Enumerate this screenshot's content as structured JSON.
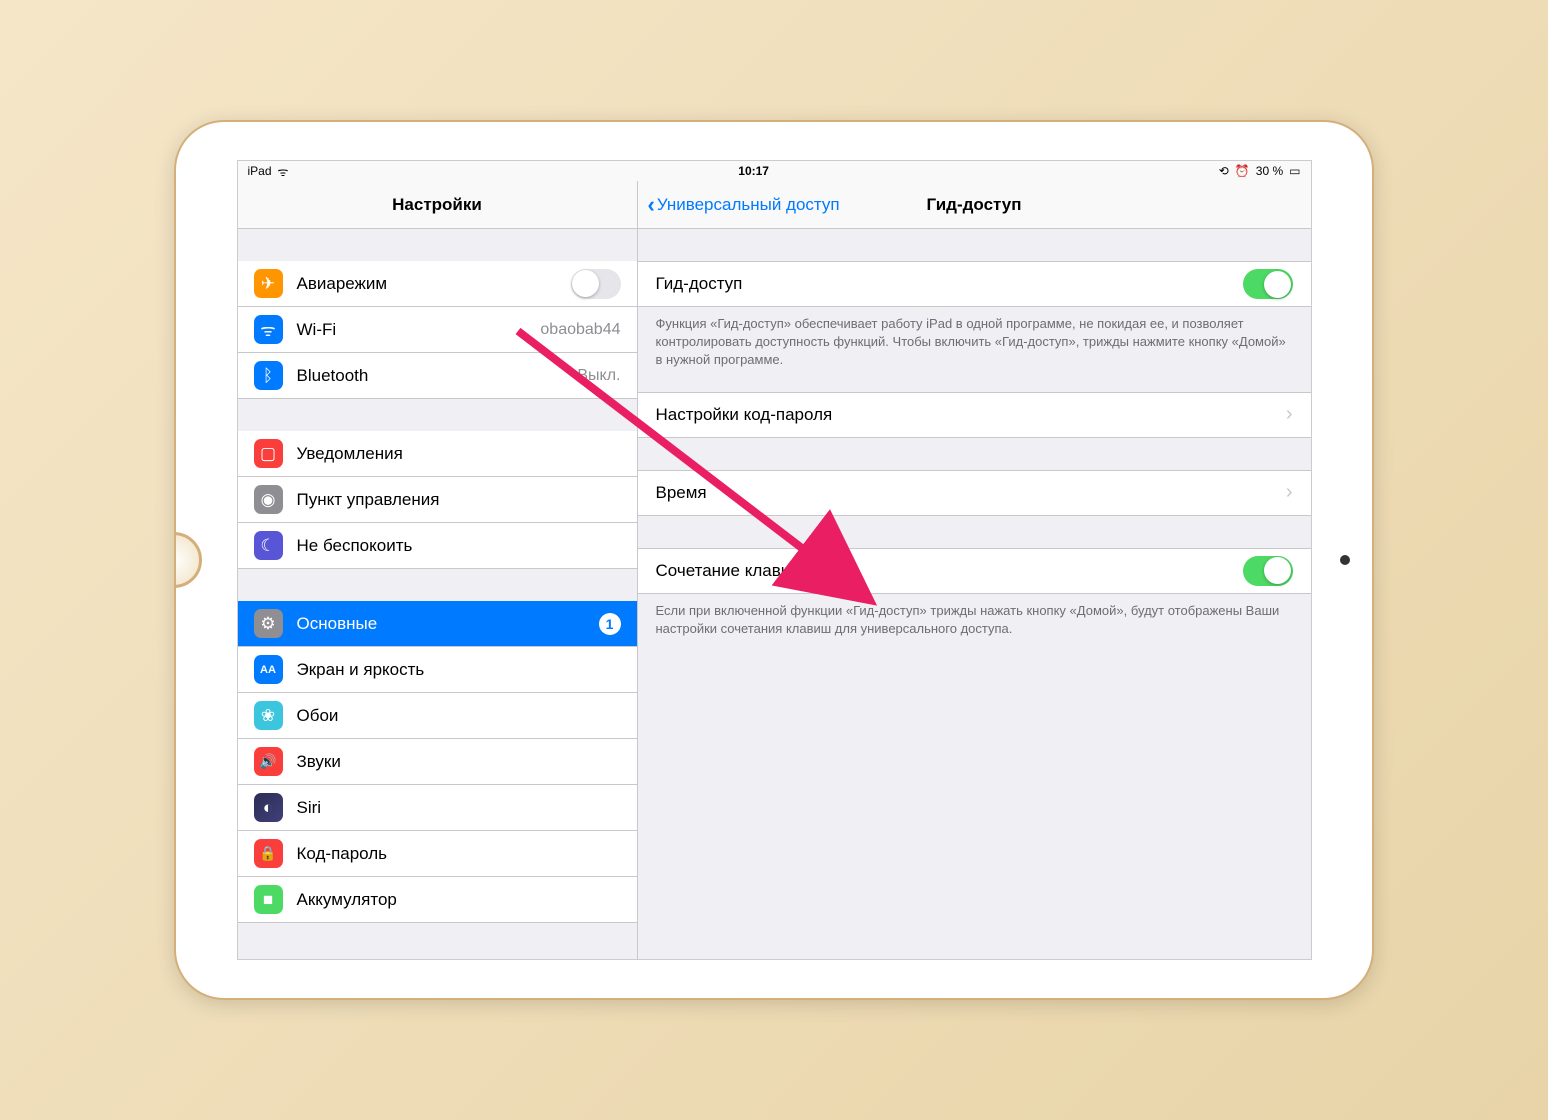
{
  "status": {
    "device": "iPad",
    "time": "10:17",
    "battery_pct": "30 %",
    "orientation_lock": true,
    "alarm": true
  },
  "sidebar": {
    "title": "Настройки",
    "groups": [
      [
        {
          "icon": "airplane",
          "label": "Авиарежим",
          "toggle": false
        },
        {
          "icon": "wifi",
          "label": "Wi-Fi",
          "value": "obaobab44"
        },
        {
          "icon": "bluetooth",
          "label": "Bluetooth",
          "value": "Выкл."
        }
      ],
      [
        {
          "icon": "notifications",
          "label": "Уведомления"
        },
        {
          "icon": "control",
          "label": "Пункт управления"
        },
        {
          "icon": "dnd",
          "label": "Не беспокоить"
        }
      ],
      [
        {
          "icon": "general",
          "label": "Основные",
          "badge": "1",
          "selected": true
        },
        {
          "icon": "display",
          "label": "Экран и яркость"
        },
        {
          "icon": "wallpaper",
          "label": "Обои"
        },
        {
          "icon": "sounds",
          "label": "Звуки"
        },
        {
          "icon": "siri",
          "label": "Siri"
        },
        {
          "icon": "passcode",
          "label": "Код-пароль"
        },
        {
          "icon": "battery",
          "label": "Аккумулятор"
        }
      ]
    ]
  },
  "main": {
    "back_label": "Универсальный доступ",
    "title": "Гид-доступ",
    "rows": {
      "guided_access": {
        "label": "Гид-доступ",
        "toggle": true
      },
      "guided_footer": "Функция «Гид-доступ» обеспечивает работу iPad в одной программе, не покидая ее, и позволяет контролировать доступность функций. Чтобы включить «Гид-доступ», трижды нажмите кнопку «Домой» в нужной программе.",
      "passcode_settings": {
        "label": "Настройки код-пароля"
      },
      "time": {
        "label": "Время"
      },
      "shortcut": {
        "label": "Сочетание клавиш",
        "toggle": true
      },
      "shortcut_footer": "Если при включенной функции «Гид-доступ» трижды нажать кнопку «Домой», будут отображены Ваши настройки сочетания клавиш для универсального доступа."
    }
  },
  "icon_glyphs": {
    "airplane": "✈",
    "wifi": "ᯤ",
    "bluetooth": "ᛒ",
    "notifications": "▢",
    "control": "◉",
    "dnd": "☾",
    "general": "⚙",
    "display": "AA",
    "wallpaper": "❀",
    "sounds": "🔊",
    "siri": "◐",
    "passcode": "🔒",
    "battery": "■"
  }
}
